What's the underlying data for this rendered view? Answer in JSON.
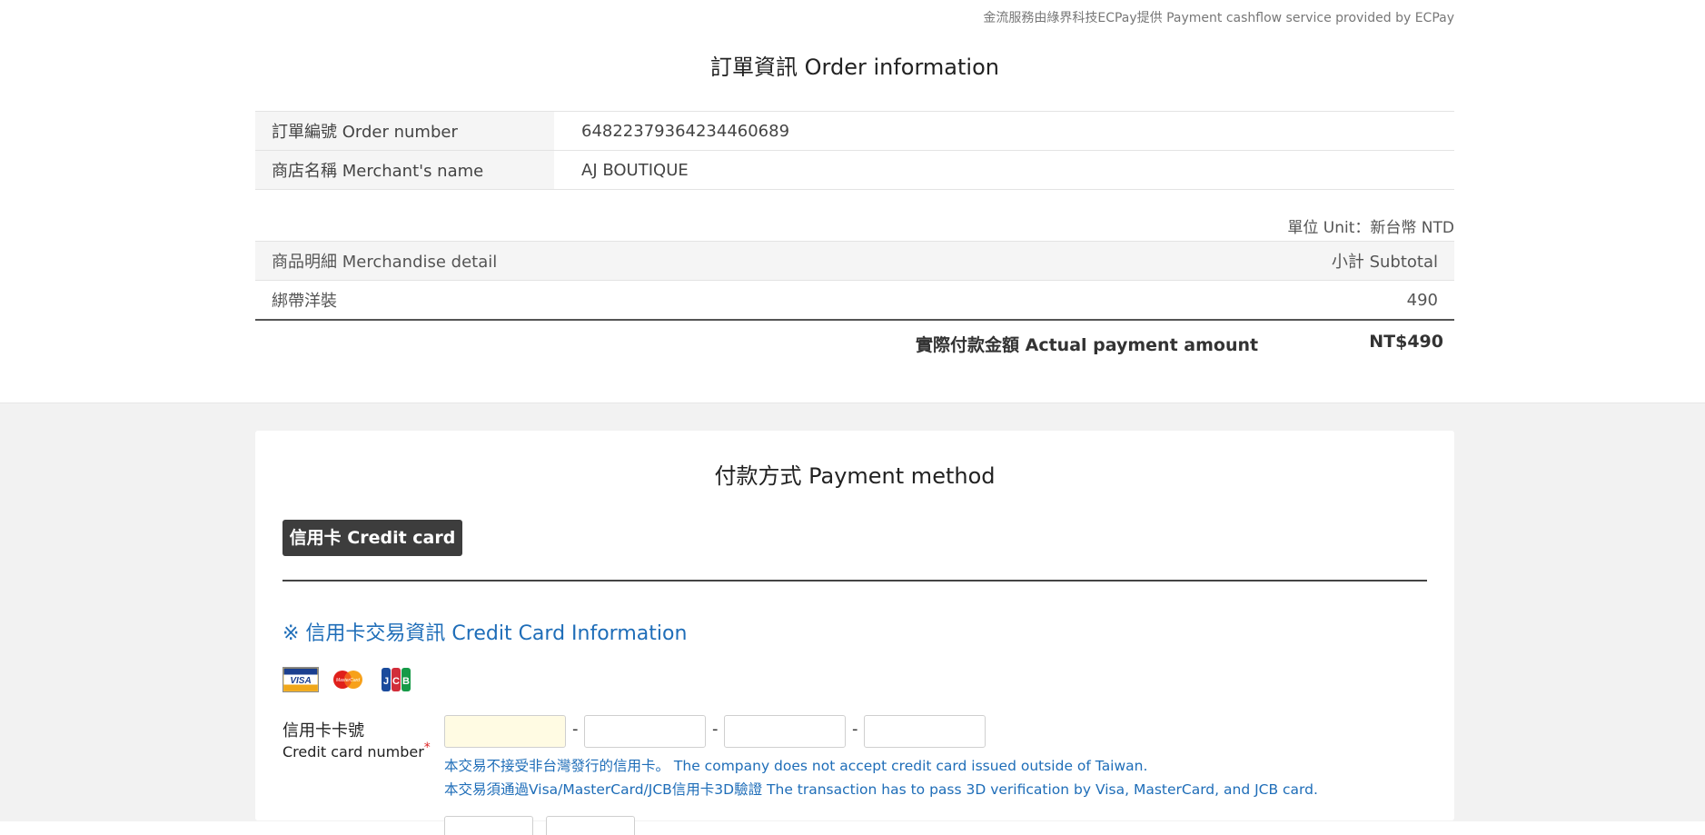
{
  "provider_text": "金流服務由綠界科技ECPay提供 Payment cashflow service provided by ECPay",
  "order": {
    "title": "訂單資訊 Order information",
    "rows": [
      {
        "label": "訂單編號 Order number",
        "value": "6482237936423446068​9"
      },
      {
        "label": "商店名稱 Merchant's name",
        "value": "AJ BOUTIQUE"
      }
    ]
  },
  "unit_text": "單位 Unit：新台幣 NTD",
  "detail": {
    "header_item": "商品明細 Merchandise detail",
    "header_subtotal": "小計 Subtotal",
    "items": [
      {
        "name": "綁帶洋裝",
        "subtotal": "490"
      }
    ],
    "actual_label": "實際付款金額 Actual payment amount",
    "actual_value": "NT$490"
  },
  "payment": {
    "title": "付款方式 Payment method",
    "tab_label": "信用卡 Credit card",
    "cc_heading": "※ 信用卡交易資訊 Credit Card Information",
    "card_logos": [
      "visa-logo",
      "mastercard-logo",
      "jcb-logo"
    ],
    "cc_label_zh": "信用卡卡號",
    "cc_label_en": "Credit card number",
    "required_mark": "*",
    "notice_1": "本交易不接受非台灣發行的信用卡。 The company does not accept credit card issued outside of Taiwan.",
    "notice_2": "本交易須通過Visa/MasterCard/JCB信用卡3D驗證 The transaction has to pass 3D verification by Visa, MasterCard, and JCB card.",
    "dash": "-"
  },
  "colors": {
    "accent_blue": "#1e6db8",
    "tab_bg": "#3d3d3d",
    "page_gray": "#f2f2f2",
    "required_red": "#dd2222",
    "active_input_bg": "#fffbe3"
  }
}
